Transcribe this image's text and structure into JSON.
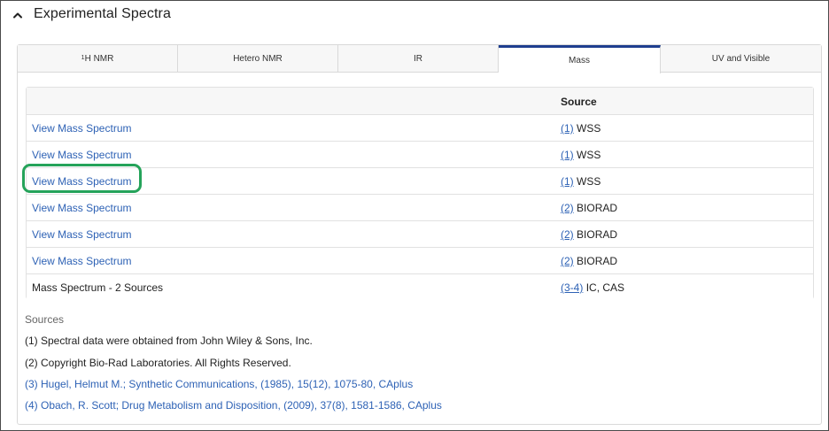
{
  "section": {
    "title": "Experimental Spectra",
    "collapse_icon": "chevron-up-icon"
  },
  "tabs": [
    {
      "sup": "1",
      "label": "H NMR",
      "active": false
    },
    {
      "sup": "",
      "label": "Hetero NMR",
      "active": false
    },
    {
      "sup": "",
      "label": "IR",
      "active": false
    },
    {
      "sup": "",
      "label": "Mass",
      "active": true
    },
    {
      "sup": "",
      "label": "UV and Visible",
      "active": false
    }
  ],
  "table": {
    "header_source": "Source",
    "rows": [
      {
        "spectrum": "View Mass Spectrum",
        "ref": "(1)",
        "source": "WSS"
      },
      {
        "spectrum": "View Mass Spectrum",
        "ref": "(1)",
        "source": "WSS"
      },
      {
        "spectrum": "View Mass Spectrum",
        "ref": "(1)",
        "source": "WSS"
      },
      {
        "spectrum": "View Mass Spectrum",
        "ref": "(2)",
        "source": "BIORAD"
      },
      {
        "spectrum": "View Mass Spectrum",
        "ref": "(2)",
        "source": "BIORAD"
      },
      {
        "spectrum": "View Mass Spectrum",
        "ref": "(2)",
        "source": "BIORAD"
      },
      {
        "spectrum": "Mass Spectrum - 2 Sources",
        "ref": "(3-4)",
        "source": "IC, CAS"
      }
    ]
  },
  "sources": {
    "heading": "Sources",
    "items": [
      "(1) Spectral data were obtained from John Wiley & Sons, Inc.",
      "(2) Copyright Bio-Rad Laboratories. All Rights Reserved.",
      "(3) Hugel, Helmut M.; Synthetic Communications, (1985), 15(12), 1075-80, CAplus",
      "(4) Obach, R. Scott; Drug Metabolism and Disposition, (2009), 37(8), 1581-1586, CAplus"
    ]
  },
  "colors": {
    "link": "#2e62b5",
    "active_tab_border": "#1f3f8f",
    "highlight": "#25a35a"
  }
}
